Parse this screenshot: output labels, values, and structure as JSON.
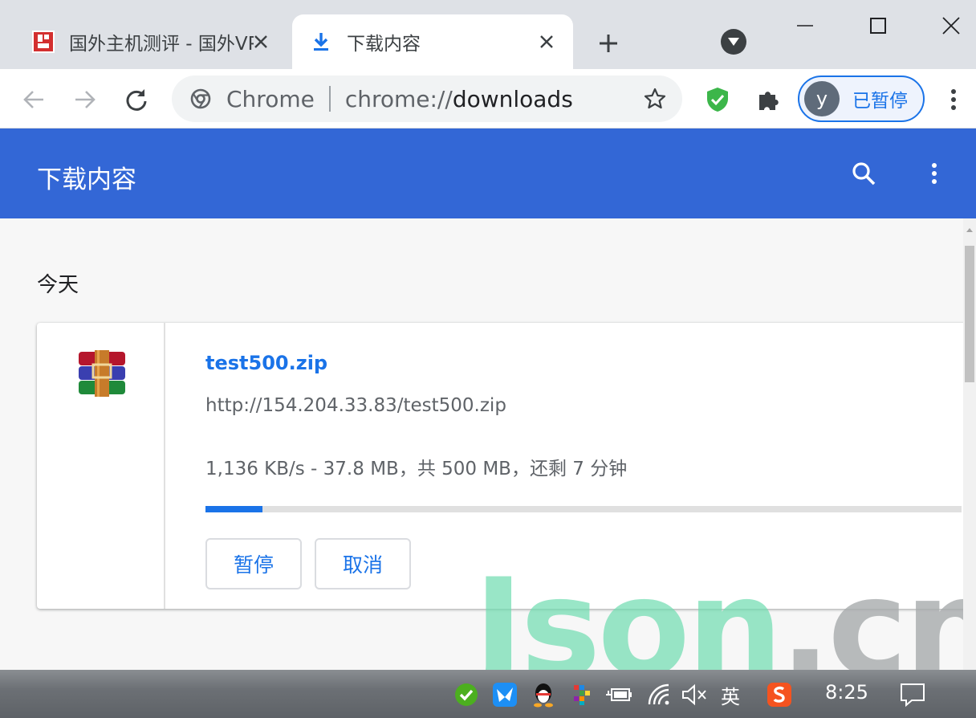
{
  "tabs": [
    {
      "title": "国外主机测评 - 国外VPS",
      "active": false
    },
    {
      "title": "下载内容",
      "active": true
    }
  ],
  "omnibox": {
    "chip": "Chrome",
    "url_prefix": "chrome://",
    "url_path": "downloads"
  },
  "profile": {
    "initial": "y",
    "label": "已暂停"
  },
  "header": {
    "title": "下载内容"
  },
  "day_label": "今天",
  "download": {
    "file_name": "test500.zip",
    "url": "http://154.204.33.83/test500.zip",
    "status": "1,136 KB/s - 37.8 MB，共 500 MB，还剩 7 分钟",
    "progress_percent": 7.56,
    "pause_label": "暂停",
    "cancel_label": "取消"
  },
  "watermark": {
    "part1": "Json",
    "part2": ".cn"
  },
  "taskbar": {
    "ime": "英",
    "time": "8:25"
  },
  "colors": {
    "accent": "#1a73e8",
    "header_bg": "#3367d6",
    "tabstrip_bg": "#dee1e6"
  }
}
